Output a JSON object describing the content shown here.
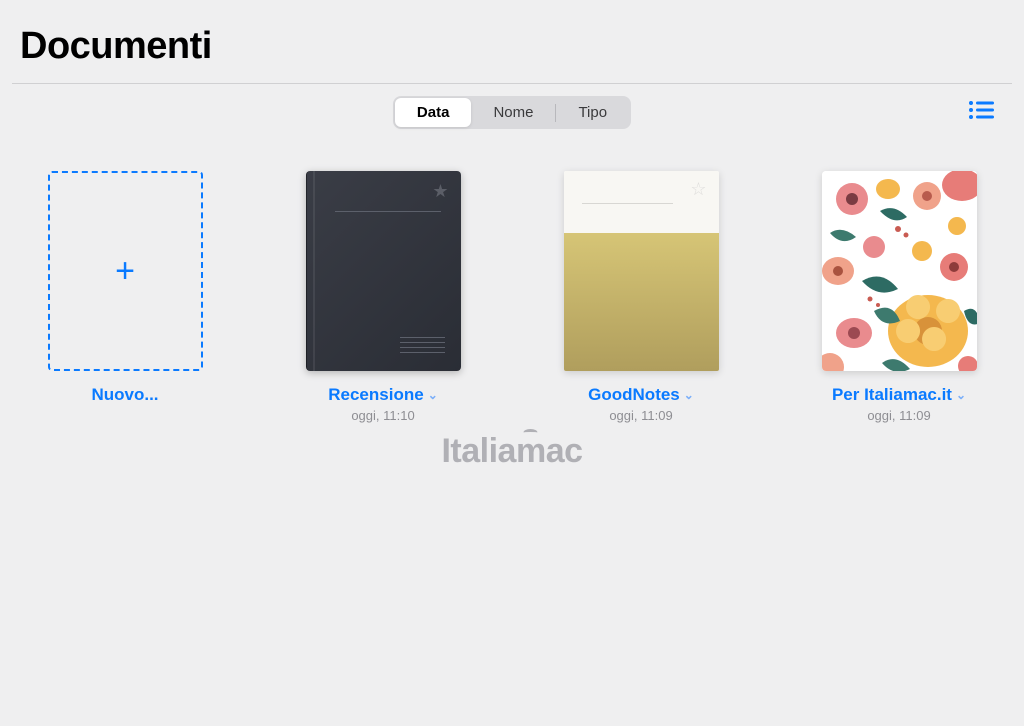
{
  "header": {
    "title": "Documenti"
  },
  "sort": {
    "options": [
      "Data",
      "Nome",
      "Tipo"
    ],
    "active": "Data"
  },
  "icons": {
    "listView": "list-icon",
    "plus": "+",
    "star": "★",
    "starOutline": "☆",
    "chevronDown": "⌄"
  },
  "items": [
    {
      "kind": "new",
      "title": "Nuovo..."
    },
    {
      "kind": "notebook",
      "title": "Recensione",
      "date": "oggi, 11:10"
    },
    {
      "kind": "sticky",
      "title": "GoodNotes",
      "date": "oggi, 11:09"
    },
    {
      "kind": "floral",
      "title": "Per Italiamac.it",
      "date": "oggi, 11:09"
    }
  ],
  "watermark": "Italiamac",
  "colors": {
    "accent": "#0a7aff",
    "bg": "#efeff0",
    "textMuted": "#8e8e93"
  }
}
